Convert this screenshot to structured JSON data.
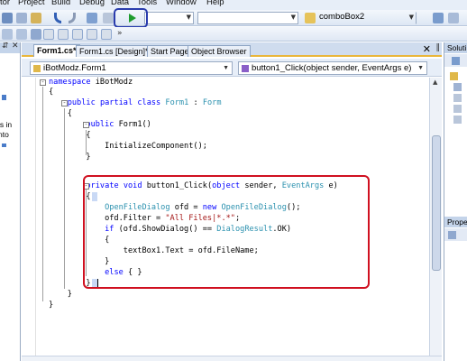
{
  "menu": {
    "items": [
      "tor",
      "Project",
      "Build",
      "Debug",
      "Data",
      "Tools",
      "Window",
      "Help"
    ]
  },
  "toolbar": {
    "run_icon": "play-icon",
    "config_combo": "",
    "platform_combo": "",
    "find_combo": "comboBox2"
  },
  "left_panel": {
    "lines": [
      "ls in",
      "nto"
    ]
  },
  "tabs": [
    {
      "label": "Form1.cs*",
      "active": true
    },
    {
      "label": "Form1.cs [Design]*",
      "active": false
    },
    {
      "label": "Start Page",
      "active": false
    },
    {
      "label": "Object Browser",
      "active": false
    }
  ],
  "tab_close_glyph": "✕",
  "nav": {
    "type_combo": "iBotModz.Form1",
    "member_combo": "button1_Click(object sender, EventArgs e)"
  },
  "code": [
    [
      {
        "t": "namespace",
        "c": "kw"
      },
      {
        "t": " iBotModz",
        "c": ""
      }
    ],
    [
      {
        "t": "{",
        "c": ""
      }
    ],
    [
      {
        "t": "    ",
        "c": ""
      },
      {
        "t": "public",
        "c": "kw"
      },
      {
        "t": " ",
        "c": ""
      },
      {
        "t": "partial",
        "c": "kw"
      },
      {
        "t": " ",
        "c": ""
      },
      {
        "t": "class",
        "c": "kw"
      },
      {
        "t": " ",
        "c": ""
      },
      {
        "t": "Form1",
        "c": "ty"
      },
      {
        "t": " : ",
        "c": ""
      },
      {
        "t": "Form",
        "c": "ty"
      }
    ],
    [
      {
        "t": "    {",
        "c": ""
      }
    ],
    [
      {
        "t": "        ",
        "c": ""
      },
      {
        "t": "public",
        "c": "kw"
      },
      {
        "t": " Form1()",
        "c": ""
      }
    ],
    [
      {
        "t": "        {",
        "c": ""
      }
    ],
    [
      {
        "t": "            InitializeComponent();",
        "c": ""
      }
    ],
    [
      {
        "t": "        }",
        "c": ""
      }
    ],
    [
      {
        "t": "",
        "c": ""
      }
    ],
    [
      {
        "t": "        ",
        "c": ""
      },
      {
        "t": "private",
        "c": "kw"
      },
      {
        "t": " ",
        "c": ""
      },
      {
        "t": "void",
        "c": "kw"
      },
      {
        "t": " button1_Click(",
        "c": ""
      },
      {
        "t": "object",
        "c": "kw"
      },
      {
        "t": " sender, ",
        "c": ""
      },
      {
        "t": "EventArgs",
        "c": "ty"
      },
      {
        "t": " e)",
        "c": ""
      }
    ],
    [
      {
        "t": "        {",
        "c": ""
      }
    ],
    [
      {
        "t": "            ",
        "c": ""
      },
      {
        "t": "OpenFileDialog",
        "c": "ty"
      },
      {
        "t": " ofd = ",
        "c": ""
      },
      {
        "t": "new",
        "c": "kw"
      },
      {
        "t": " ",
        "c": ""
      },
      {
        "t": "OpenFileDialog",
        "c": "ty"
      },
      {
        "t": "();",
        "c": ""
      }
    ],
    [
      {
        "t": "            ofd.Filter = ",
        "c": ""
      },
      {
        "t": "\"All Files|*.*\"",
        "c": "st"
      },
      {
        "t": ";",
        "c": ""
      }
    ],
    [
      {
        "t": "            ",
        "c": ""
      },
      {
        "t": "if",
        "c": "kw"
      },
      {
        "t": " (ofd.ShowDialog() == ",
        "c": ""
      },
      {
        "t": "DialogResult",
        "c": "ty"
      },
      {
        "t": ".OK)",
        "c": ""
      }
    ],
    [
      {
        "t": "            {",
        "c": ""
      }
    ],
    [
      {
        "t": "                textBox1.Text = ofd.FileName;",
        "c": ""
      }
    ],
    [
      {
        "t": "            }",
        "c": ""
      }
    ],
    [
      {
        "t": "            ",
        "c": ""
      },
      {
        "t": "else",
        "c": "kw"
      },
      {
        "t": " { }",
        "c": ""
      }
    ],
    [
      {
        "t": "        }",
        "c": ""
      }
    ],
    [
      {
        "t": "    }",
        "c": ""
      }
    ],
    [
      {
        "t": "}",
        "c": ""
      }
    ]
  ],
  "right_panel": {
    "solution_header": "Soluti",
    "properties_header": "Prope"
  },
  "colors": {
    "highlight_red": "#d01020",
    "highlight_blue": "#2a3cad",
    "keyword": "#0000ff",
    "type": "#2b91af",
    "string": "#a31515"
  }
}
